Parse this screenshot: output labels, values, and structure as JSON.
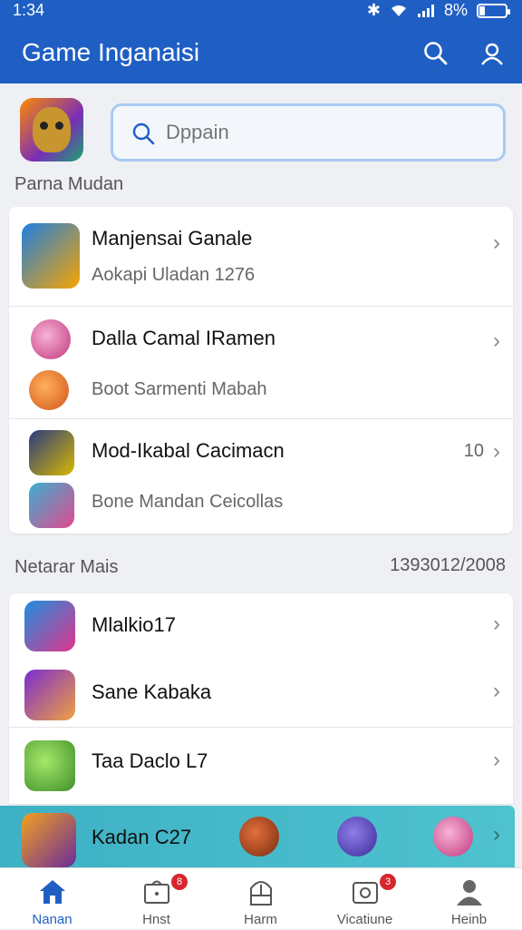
{
  "status": {
    "time": "1:34",
    "battery": "8%"
  },
  "app_bar": {
    "title": "Game Inganaisi"
  },
  "search": {
    "placeholder": "Dppain"
  },
  "section1": {
    "label": "Parna Mudan"
  },
  "list1": [
    {
      "title": "Manjensai Ganale",
      "subtitle": "Aokapi Uladan 1276"
    },
    {
      "title": "Dalla Camal IRamen",
      "subtitle": "Boot Sarmenti Mabah"
    },
    {
      "title": "Mod-Ikabal Cacimacn",
      "subtitle": "Bone Mandan Ceicollas",
      "count": "10"
    }
  ],
  "section2": {
    "label": "Netarar Mais",
    "value": "1393012/2008"
  },
  "list2": [
    {
      "title": "Mlalkio17"
    },
    {
      "title": "Sane Kabaka"
    },
    {
      "title": "Taa Daclo L7"
    }
  ],
  "promo": {
    "title": "Kadan C27"
  },
  "nav": [
    {
      "label": "Nanan"
    },
    {
      "label": "Hnst",
      "badge": "8"
    },
    {
      "label": "Harm"
    },
    {
      "label": "Vicatiune",
      "badge": "3"
    },
    {
      "label": "Heinb"
    }
  ],
  "colors": {
    "primary": "#1f5fc4",
    "badge": "#d7262e",
    "promo": "#3db1c4"
  }
}
